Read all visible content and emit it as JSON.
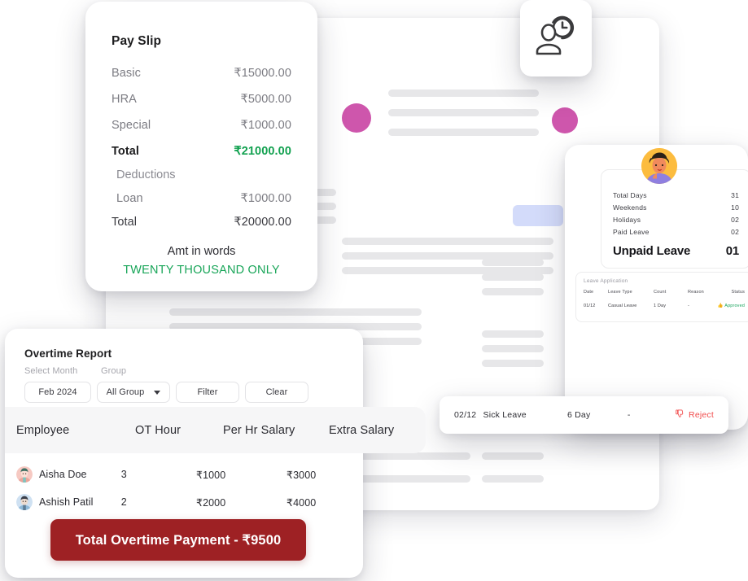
{
  "payslip": {
    "title": "Pay Slip",
    "rows": [
      {
        "label": "Basic",
        "value": "₹15000.00"
      },
      {
        "label": "HRA",
        "value": "₹5000.00"
      },
      {
        "label": "Special",
        "value": "₹1000.00"
      }
    ],
    "total_label": "Total",
    "total_value": "₹21000.00",
    "deductions_label": "Deductions",
    "loan_label": "Loan",
    "loan_value": "₹1000.00",
    "net_label": "Total",
    "net_value": "₹20000.00",
    "words_label": "Amt in words",
    "words_value": "TWENTY THOUSAND ONLY",
    "accent_green": "#12a150"
  },
  "attendance_badge": {
    "icon": "user-clock-icon"
  },
  "leave_card": {
    "avatar": "employee-avatar",
    "summary": [
      {
        "label": "Total Days",
        "value": "31"
      },
      {
        "label": "Weekends",
        "value": "10"
      },
      {
        "label": "Holidays",
        "value": "02"
      },
      {
        "label": "Paid Leave",
        "value": "02"
      }
    ],
    "unpaid_label": "Unpaid Leave",
    "unpaid_value": "01",
    "table": {
      "title": "Leave Application",
      "columns": [
        "Date",
        "Leave Type",
        "Count",
        "Reason",
        "Status"
      ],
      "rows": [
        {
          "date": "01/12",
          "type": "Casual Leave",
          "count": "1 Day",
          "reason": "-",
          "status": "Approved"
        }
      ],
      "status_color": "#17a45c"
    }
  },
  "sick_strip": {
    "date": "02/12",
    "type": "Sick Leave",
    "count": "6 Day",
    "reason": "-",
    "action": "Reject",
    "action_color": "#f14b4b"
  },
  "overtime": {
    "title": "Overtime Report",
    "filter_labels": {
      "month": "Select Month",
      "group": "Group"
    },
    "controls": {
      "month_value": "Feb 2024",
      "group_value": "All Group",
      "filter_label": "Filter",
      "clear_label": "Clear"
    },
    "columns": [
      "Employee",
      "OT Hour",
      "Per Hr Salary",
      "Extra Salary"
    ],
    "rows": [
      {
        "name": "Aisha Doe",
        "ot_hour": "3",
        "per_hr": "₹1000",
        "extra": "₹3000"
      },
      {
        "name": "Ashish Patil",
        "ot_hour": "2",
        "per_hr": "₹2000",
        "extra": "₹4000"
      }
    ],
    "total_label": "Total Overtime Payment - ₹9500",
    "total_color": "#9e2124"
  },
  "decor": {
    "dot_color": "#ce56ac",
    "chip_color": "#d3dbfa",
    "line_color": "#e7e7e9"
  }
}
